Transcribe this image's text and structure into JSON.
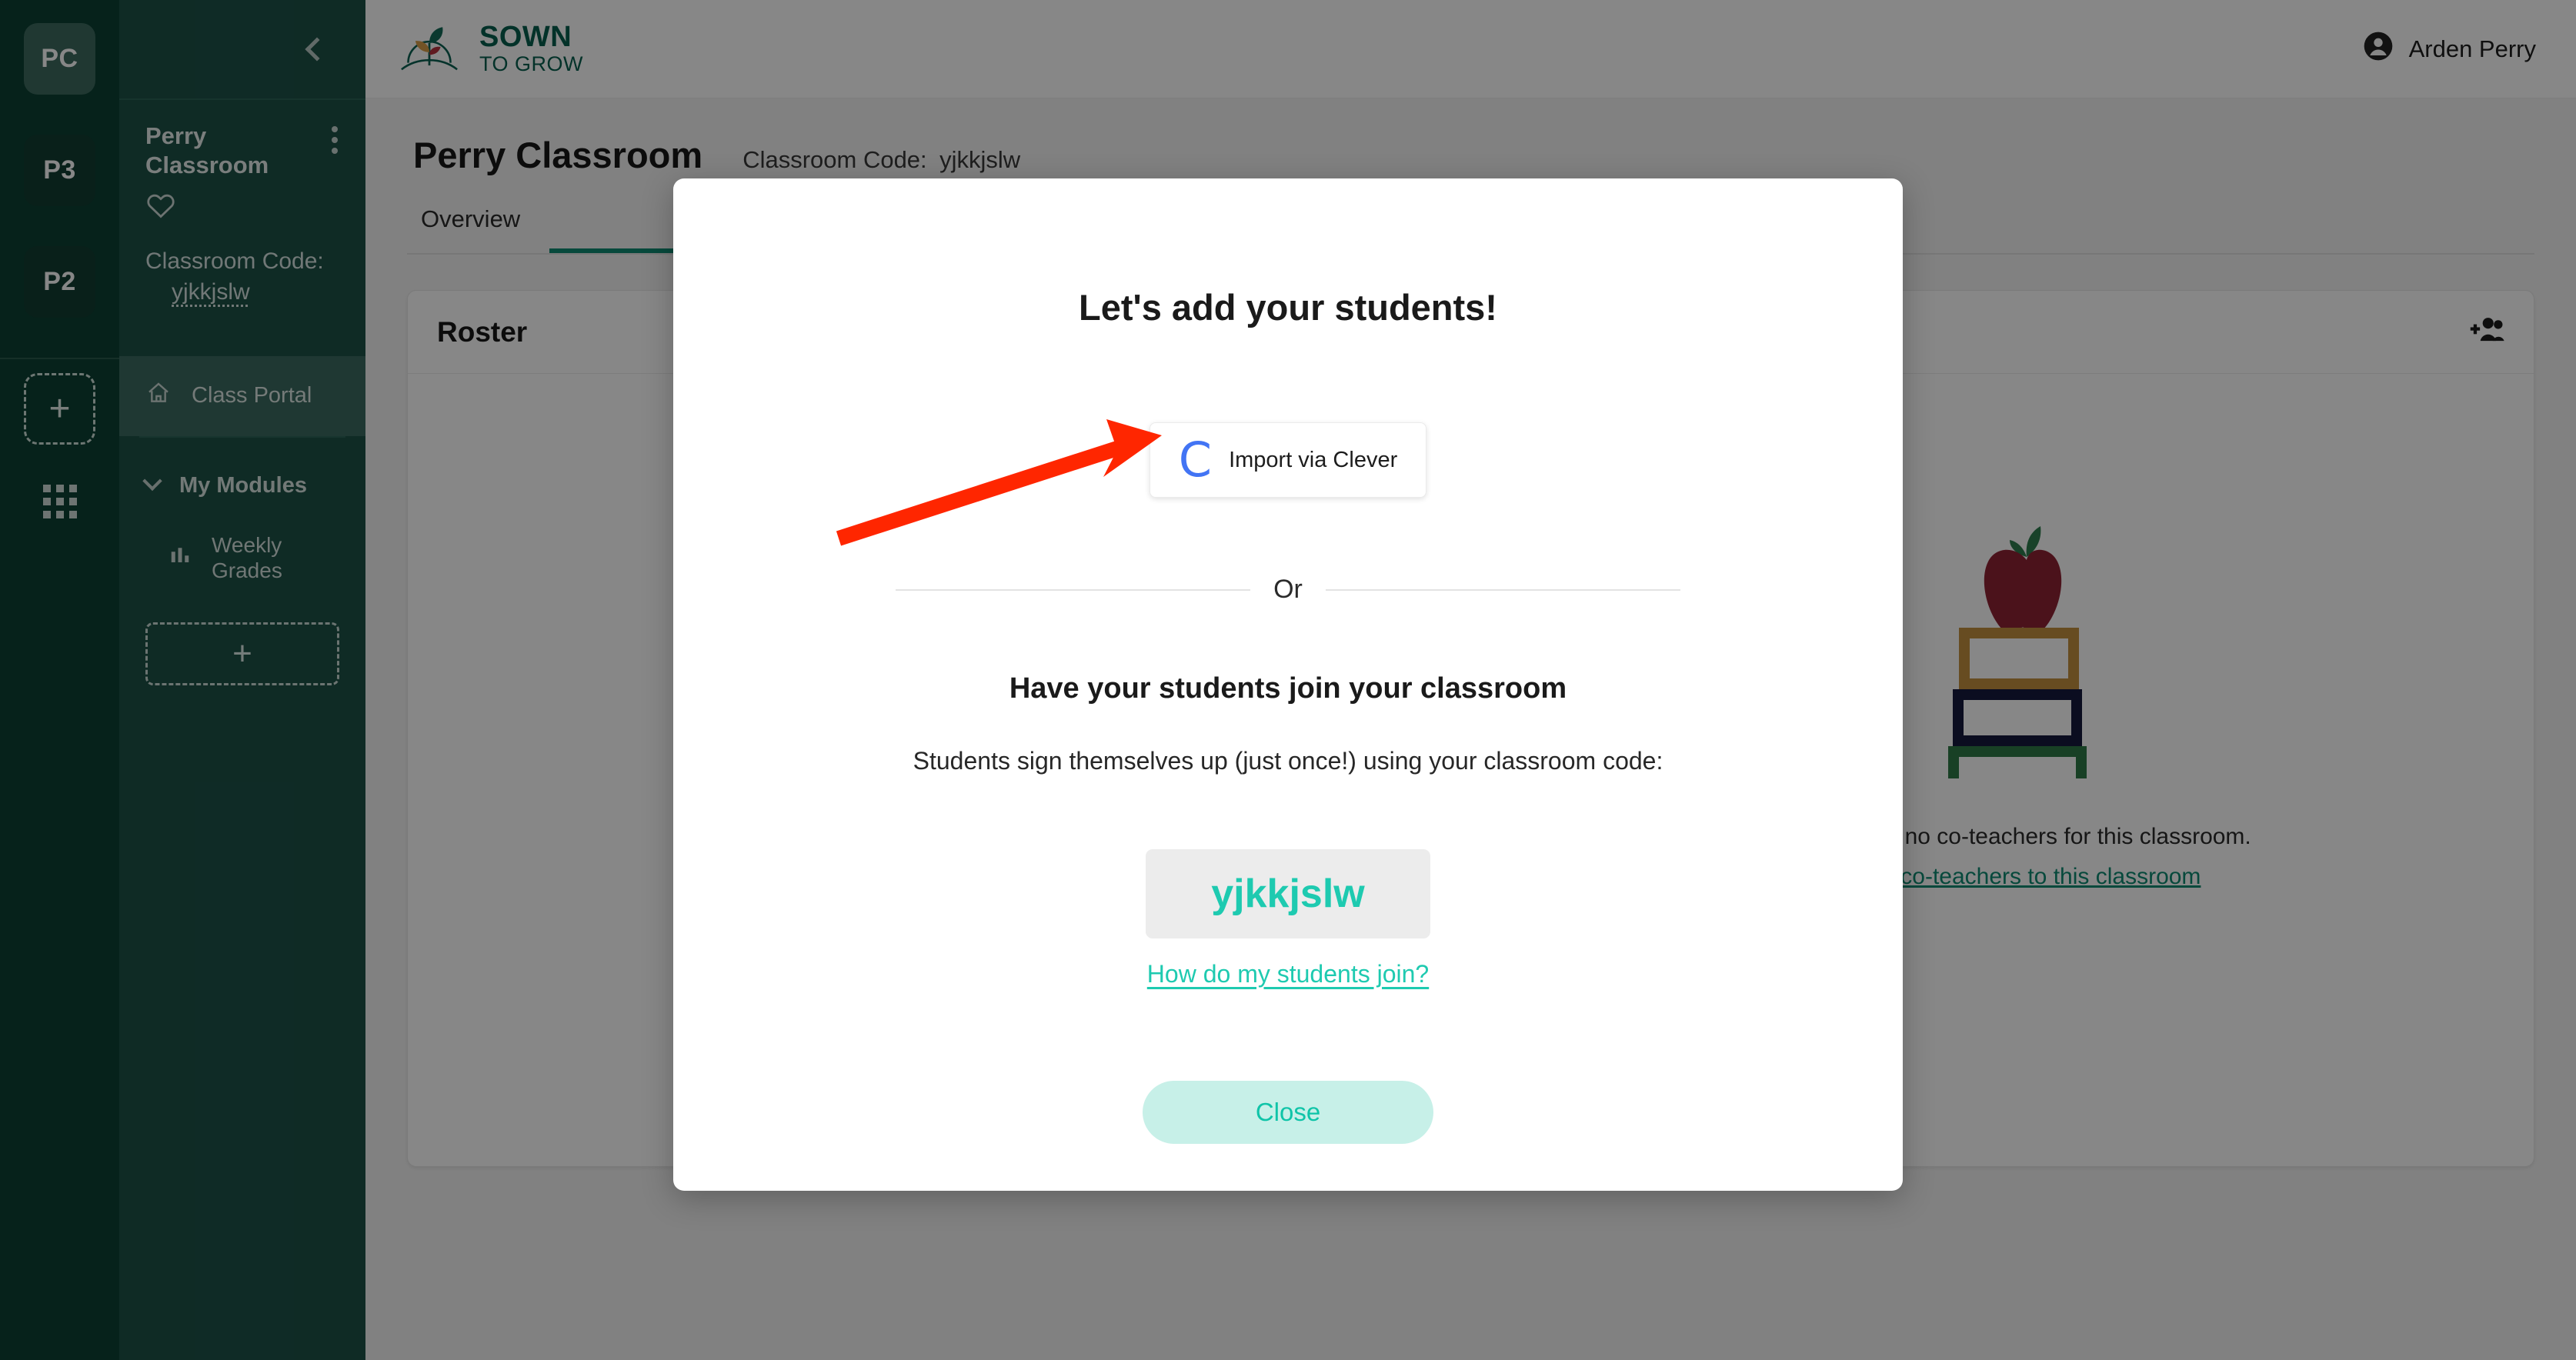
{
  "brand": {
    "line1": "SOWN",
    "line2": "TO GROW",
    "logo_icon": "plant-sprout-logo"
  },
  "topbar": {
    "user_name": "Arden Perry",
    "user_icon": "account-circle-icon"
  },
  "rail": {
    "tiles": [
      {
        "label": "PC",
        "active": true
      },
      {
        "label": "P3",
        "active": false
      },
      {
        "label": "P2",
        "active": false
      }
    ],
    "add_label": "+",
    "apps_icon": "apps-grid-icon"
  },
  "sidebar": {
    "collapse_icon": "chevron-left-icon",
    "class_name": "Perry Classroom",
    "kebab_icon": "more-vertical-icon",
    "favorite_icon": "heart-outline-icon",
    "code_label": "Classroom Code:",
    "code_value": "yjkkjslw",
    "nav": {
      "label": "Class Portal",
      "icon": "home-icon"
    },
    "modules_section": {
      "label": "My Modules",
      "icon": "chevron-down-icon"
    },
    "modules": [
      {
        "label": "Weekly Grades",
        "icon": "bar-chart-icon"
      }
    ],
    "add_module_label": "+"
  },
  "page": {
    "title": "Perry Classroom",
    "code_label": "Classroom Code:",
    "code_value": "yjkkjslw",
    "tabs": [
      {
        "label": "Overview",
        "active": false
      },
      {
        "label": "",
        "active": true
      }
    ]
  },
  "roster_card": {
    "title": "Roster",
    "add_students_icon": "add-group-icon"
  },
  "coteacher_card": {
    "illustration": "apple-on-books-illustration",
    "empty_text": "You have no co-teachers for this classroom.",
    "link_text": "Add co-teachers to this classroom"
  },
  "modal": {
    "title": "Let's add your students!",
    "clever_button": {
      "label": "Import via Clever",
      "icon": "clever-c-logo"
    },
    "or_label": "Or",
    "join_heading": "Have your students join your classroom",
    "join_subtext": "Students sign themselves up (just once!) using your classroom code:",
    "class_code": "yjkkjslw",
    "help_link": "How do my students join?",
    "close_label": "Close"
  },
  "annotation": {
    "arrow": "red-arrow-pointing-to-clever-button",
    "color": "#FF2600"
  },
  "colors": {
    "rail_bg": "#0C4033",
    "sidebar_bg": "#1D5147",
    "brand_green": "#075F4E",
    "teal_accent": "#1ECAB0",
    "clever_blue": "#4274F4",
    "annotation_red": "#FF2600"
  }
}
